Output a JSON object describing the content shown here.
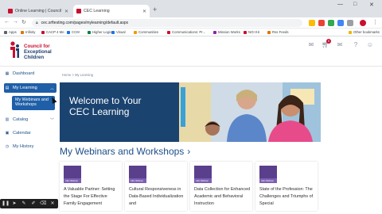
{
  "browser": {
    "tabs": [
      {
        "label": "Online Learning | Council for Exc...",
        "active": false
      },
      {
        "label": "CEC Learning",
        "active": true
      }
    ],
    "new_tab": "+",
    "window_controls": [
      "—",
      "□",
      "✕"
    ],
    "url": "cec.srftesting.com/pages/mylearning/default.aspx",
    "bookmarks": [
      {
        "label": "Apps",
        "color": "#5f6368"
      },
      {
        "label": "Infinity",
        "color": "#e37400"
      },
      {
        "label": "CACP 4 Me",
        "color": "#c8102e"
      },
      {
        "label": "CCM",
        "color": "#1a73e8"
      },
      {
        "label": "Higher Logic",
        "color": "#0b8043"
      },
      {
        "label": "Visual",
        "color": "#1a73e8"
      },
      {
        "label": "Communities",
        "color": "#f29900"
      },
      {
        "label": "Communications: Pr...",
        "color": "#c8102e"
      },
      {
        "label": "Mission Works",
        "color": "#8e24aa"
      },
      {
        "label": "NOI Kit",
        "color": "#c8102e"
      },
      {
        "label": "Rss Feeds",
        "color": "#e37400"
      },
      {
        "label": "Other bookmarks",
        "color": "#f4b400"
      }
    ]
  },
  "header": {
    "logo_lines": [
      "Council for",
      "Exceptional",
      "Children"
    ],
    "logo_colors": {
      "red": "#c8102e",
      "navy": "#1c3f6e"
    },
    "cart_badge": "0"
  },
  "sidebar": {
    "items": [
      {
        "label": "Dashboard",
        "icon": "dashboard-icon"
      },
      {
        "label": "My Learning",
        "icon": "learning-icon",
        "active": true
      },
      {
        "label": "Catalog",
        "icon": "catalog-icon"
      },
      {
        "label": "Calendar",
        "icon": "calendar-icon"
      },
      {
        "label": "My History",
        "icon": "history-icon"
      }
    ],
    "sub_item": "My Webinars and Workshops"
  },
  "main": {
    "breadcrumb": "Home  >  My Learning",
    "hero_title": "Welcome to Your CEC Learning",
    "section_title": "My Webinars and Workshops",
    "section_arrow": "›",
    "cards": [
      {
        "title": "A Valuable Partner: Setting the Stage For Effective Family Engagement",
        "thumb_label": "CEC Webinar"
      },
      {
        "title": "Cultural Responsiveness in Data-Based Individualization and",
        "thumb_label": "CEC Webinar"
      },
      {
        "title": "Data Collection for Enhanced Academic and Behavioral Instruction",
        "thumb_label": "CEC Webinar"
      },
      {
        "title": "State of the Profession: The Challenges and Triumphs of Special",
        "thumb_label": "CEC Webinar"
      }
    ]
  },
  "colors": {
    "accent": "#1f5fa8",
    "hero_navy": "#1b4370",
    "link_blue": "#1c4f8a",
    "webinar_purple": "#5a3f8c"
  }
}
